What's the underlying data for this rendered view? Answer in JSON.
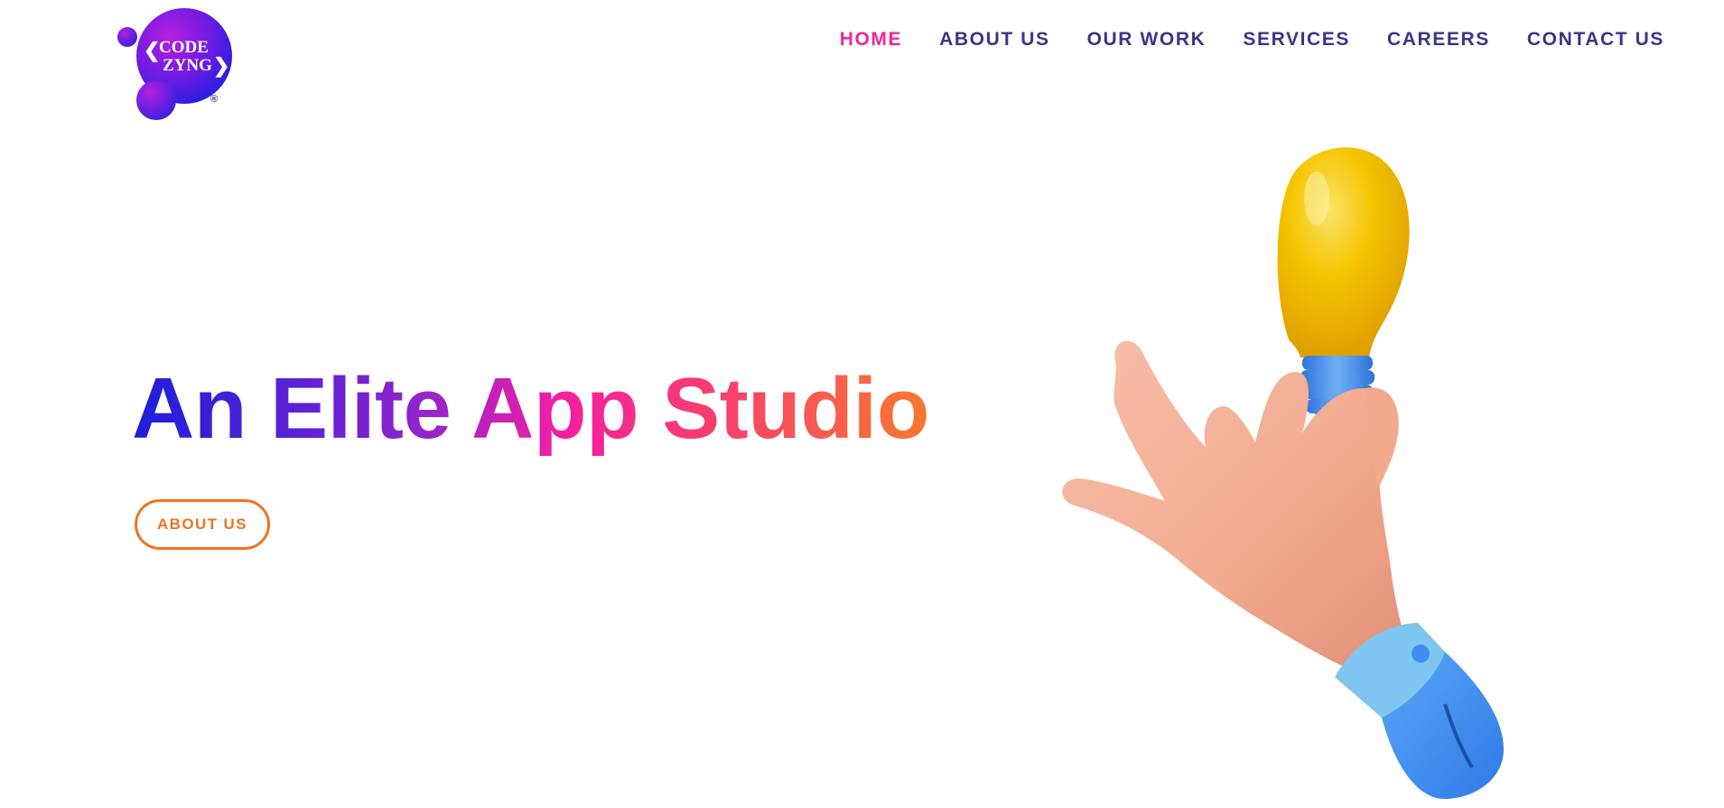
{
  "logo": {
    "line1": "CODE",
    "line2": "ZYNG",
    "registered": "®",
    "colors": {
      "purple": "#8d17d9",
      "blue": "#2a1fe0"
    }
  },
  "nav": {
    "items": [
      {
        "label": "HOME",
        "active": true
      },
      {
        "label": "ABOUT US",
        "active": false
      },
      {
        "label": "OUR WORK",
        "active": false
      },
      {
        "label": "SERVICES",
        "active": false
      },
      {
        "label": "CAREERS",
        "active": false
      },
      {
        "label": "CONTACT US",
        "active": false
      }
    ],
    "colors": {
      "default": "#3a3688",
      "active": "#f0269a"
    }
  },
  "hero": {
    "title": "An Elite App Studio",
    "button_label": "ABOUT US",
    "gradient": [
      "#1c1fd8",
      "#9a23c9",
      "#f51fa2",
      "#f8782e"
    ],
    "button_color": "#f07420"
  },
  "illustration": {
    "icon": "hand-holding-lightbulb-icon",
    "colors": {
      "bulb": "#f5c400",
      "bulb_base": "#3f8df0",
      "skin": "#f3a98f",
      "sleeve": "#3b8ff2",
      "cuff": "#7ec6f0"
    }
  }
}
